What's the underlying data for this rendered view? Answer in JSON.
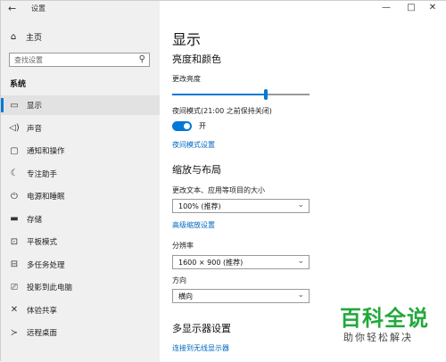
{
  "titlebar": {
    "title": "设置",
    "back_icon": "back-arrow-icon"
  },
  "window_controls": {
    "minimize": "—",
    "maximize": "□",
    "close": "✕"
  },
  "sidebar": {
    "home_label": "主页",
    "search_placeholder": "查找设置",
    "section_label": "系统",
    "items": [
      {
        "label": "显示",
        "icon": "monitor-icon",
        "glyph": "▭",
        "active": true
      },
      {
        "label": "声音",
        "icon": "speaker-icon",
        "glyph": "◁)",
        "active": false
      },
      {
        "label": "通知和操作",
        "icon": "notification-icon",
        "glyph": "▢",
        "active": false
      },
      {
        "label": "专注助手",
        "icon": "moon-icon",
        "glyph": "☾",
        "active": false
      },
      {
        "label": "电源和睡眠",
        "icon": "power-icon",
        "glyph": "⏻",
        "active": false
      },
      {
        "label": "存储",
        "icon": "storage-icon",
        "glyph": "▬",
        "active": false
      },
      {
        "label": "平板模式",
        "icon": "tablet-icon",
        "glyph": "⊡",
        "active": false
      },
      {
        "label": "多任务处理",
        "icon": "multitask-icon",
        "glyph": "⊟",
        "active": false
      },
      {
        "label": "投影到此电脑",
        "icon": "project-icon",
        "glyph": "⎚",
        "active": false
      },
      {
        "label": "体验共享",
        "icon": "share-icon",
        "glyph": "✕",
        "active": false
      },
      {
        "label": "远程桌面",
        "icon": "remote-icon",
        "glyph": "≻",
        "active": false
      }
    ]
  },
  "main": {
    "page_title": "显示",
    "brightness_heading": "亮度和颜色",
    "brightness_label": "更改亮度",
    "brightness_value": 0.68,
    "night_label": "夜间模式(21:00 之前保持关闭)",
    "night_toggle_text": "开",
    "night_link": "夜间模式设置",
    "scale_heading": "缩放与布局",
    "scale_label": "更改文本、应用等项目的大小",
    "scale_value": "100% (推荐)",
    "advanced_link": "高级缩放设置",
    "resolution_label": "分辨率",
    "resolution_value": "1600 × 900 (推荐)",
    "orientation_label": "方向",
    "orientation_value": "横向",
    "multi_heading": "多显示器设置",
    "wireless_link": "连接到无线显示器"
  },
  "watermark": {
    "title": "百科全说",
    "subtitle": "助你轻松解决"
  },
  "colors": {
    "accent": "#0078d7",
    "link": "#0067c0",
    "watermark": "#21a93b"
  }
}
